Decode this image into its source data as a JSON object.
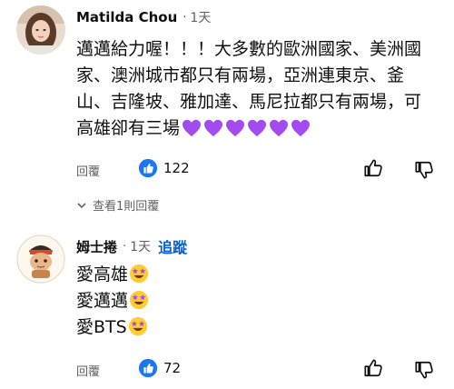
{
  "comments": [
    {
      "author": "Matilda Chou",
      "separator": "·",
      "time": "1天",
      "lines": [
        "邁邁給力喔！！！大多數的歐洲國家、美洲國",
        "家、澳洲城市都只有兩場，亞洲連東京、釜",
        "山、吉隆坡、雅加達、馬尼拉都只有兩場，可",
        "高雄卻有三場"
      ],
      "emoji": "purple-heart x6",
      "reply_label": "回覆",
      "like_count": "122",
      "view_replies": "查看1則回覆"
    },
    {
      "author": "姆士捲",
      "separator": "·",
      "time": "1天",
      "follow_label": "追蹤",
      "lines": [
        "愛高雄",
        "愛邁邁",
        "愛BTS"
      ],
      "emoji": "star-struck",
      "reply_label": "回覆",
      "like_count": "72"
    }
  ],
  "colors": {
    "accent": "#065fd4",
    "heart": "#a24cf0",
    "muted": "#606060",
    "text": "#0f0f0f"
  }
}
